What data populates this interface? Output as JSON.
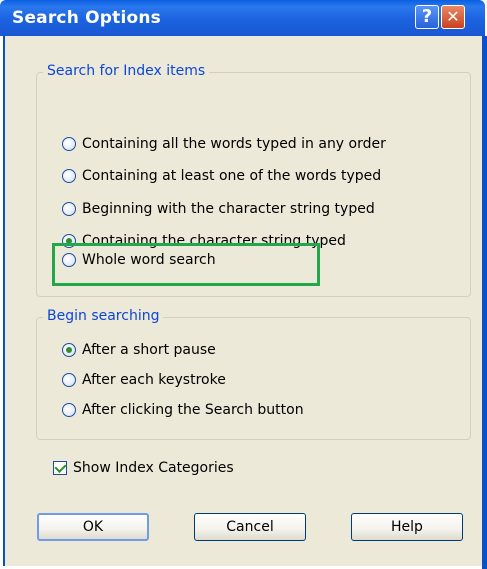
{
  "window": {
    "title": "Search Options",
    "help_glyph": "?",
    "close_glyph": "✕"
  },
  "search_group": {
    "legend": "Search for Index items",
    "options": [
      {
        "label": "Containing all the words typed in any order",
        "checked": false
      },
      {
        "label": "Containing at least one of the words typed",
        "checked": false
      },
      {
        "label": "Beginning with the character string typed",
        "checked": false
      },
      {
        "label": "Containing the character string typed",
        "checked": true
      },
      {
        "label": "Whole word search",
        "checked": false
      }
    ]
  },
  "begin_group": {
    "legend": "Begin searching",
    "options": [
      {
        "label": "After a short pause",
        "checked": true
      },
      {
        "label": "After each keystroke",
        "checked": false
      },
      {
        "label": "After clicking the Search button",
        "checked": false
      }
    ]
  },
  "show_categories": {
    "label": "Show Index Categories",
    "checked": true
  },
  "buttons": {
    "ok": "OK",
    "cancel": "Cancel",
    "help": "Help"
  },
  "colors": {
    "titlebar": "#1c63df",
    "legend_text": "#0b46d8",
    "highlight_box": "#22a84a",
    "dialog_bg": "#ede9d8"
  }
}
